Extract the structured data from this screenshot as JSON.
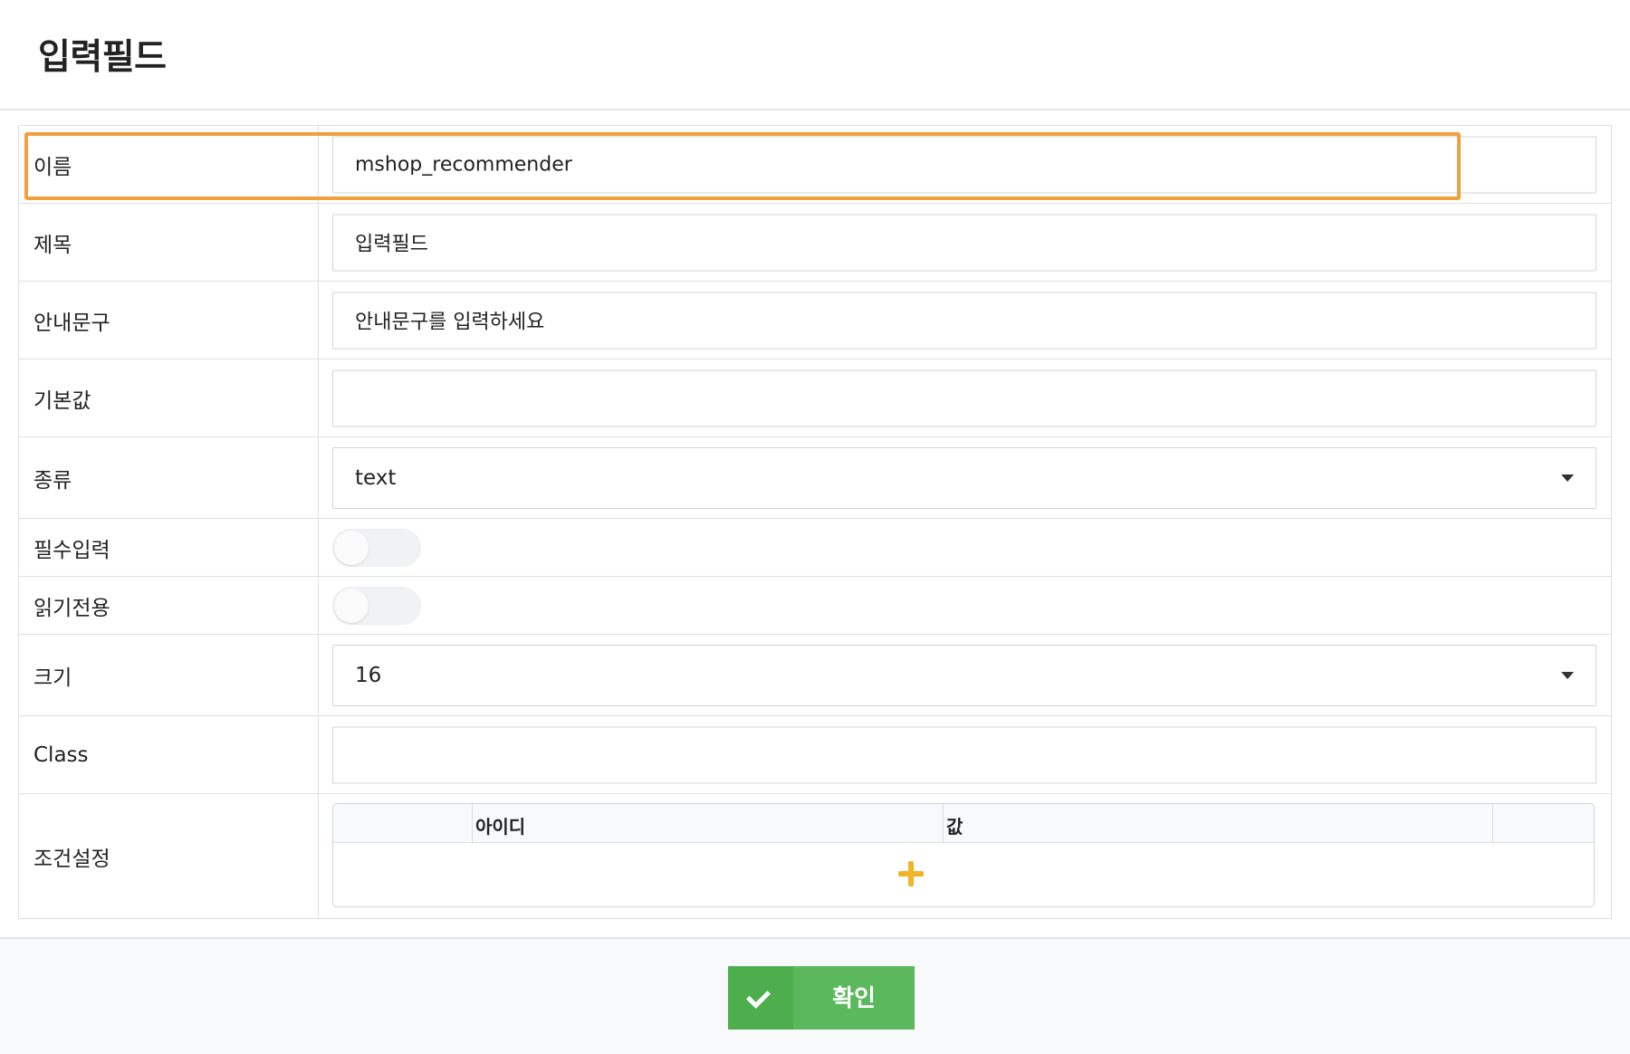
{
  "dialog": {
    "title": "입력필드"
  },
  "fields": {
    "name": {
      "label": "이름",
      "value": "mshop_recommender"
    },
    "subject": {
      "label": "제목",
      "value": "입력필드"
    },
    "placeholder": {
      "label": "안내문구",
      "value": "안내문구를 입력하세요"
    },
    "default": {
      "label": "기본값",
      "value": ""
    },
    "type": {
      "label": "종류",
      "value": "text"
    },
    "required": {
      "label": "필수입력",
      "on": false
    },
    "readonly": {
      "label": "읽기전용",
      "on": false
    },
    "size": {
      "label": "크기",
      "value": "16"
    },
    "class": {
      "label": "Class",
      "value": ""
    },
    "conditions": {
      "label": "조건설정",
      "col_id": "아이디",
      "col_value": "값"
    }
  },
  "footer": {
    "confirm_label": "확인"
  },
  "colors": {
    "highlight": "#f0a03c",
    "confirm": "#5cb85c",
    "add": "#f0b429"
  },
  "icons": {
    "add": "plus-icon",
    "confirm": "check-icon",
    "dropdown": "caret-down-icon"
  }
}
